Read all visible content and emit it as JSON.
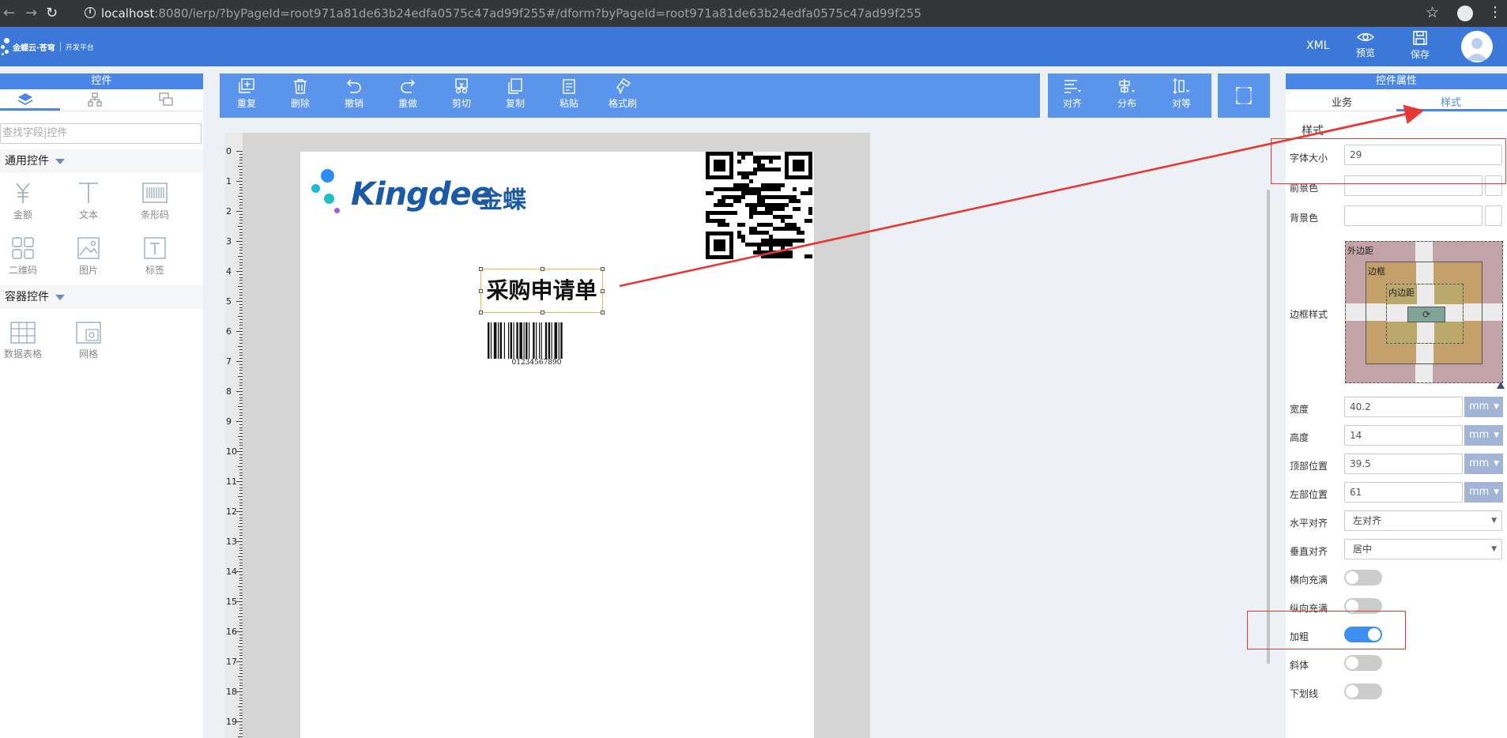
{
  "browser": {
    "url_host": "localhost",
    "url_rest": ":8080/ierp/?byPageId=root971a81de63b24edfa0575c47ad99f255#/dform?byPageId=root971a81de63b24edfa0575c47ad99f255"
  },
  "header": {
    "brand_name": "金蝶云·苍穹",
    "brand_platform": "开发平台",
    "xml": "XML",
    "preview": "预览",
    "save": "保存"
  },
  "left_panel": {
    "title": "控件",
    "search_placeholder": "查找字段|控件",
    "general_section": "通用控件",
    "general_controls": [
      {
        "label": "金额",
        "icon": "yen-icon"
      },
      {
        "label": "文本",
        "icon": "text-t-icon"
      },
      {
        "label": "条形码",
        "icon": "barcode-icon"
      },
      {
        "label": "二维码",
        "icon": "qrcode-icon"
      },
      {
        "label": "图片",
        "icon": "image-icon"
      },
      {
        "label": "标签",
        "icon": "label-t-icon"
      }
    ],
    "container_section": "容器控件",
    "container_controls": [
      {
        "label": "数据表格",
        "icon": "table-icon"
      },
      {
        "label": "网格",
        "icon": "grid-icon"
      }
    ]
  },
  "toolbar": {
    "items": [
      "重复",
      "删除",
      "撤销",
      "重做",
      "剪切",
      "复制",
      "粘贴",
      "格式刷"
    ],
    "align_items": [
      "对齐",
      "分布",
      "对等"
    ]
  },
  "canvas": {
    "ruler_marks": [
      "0",
      "1",
      "2",
      "3",
      "4",
      "5",
      "6",
      "7",
      "8",
      "9",
      "10",
      "11",
      "12",
      "13",
      "14",
      "15",
      "16",
      "17",
      "18",
      "19"
    ],
    "logo_text": "Kingdee",
    "logo_cn": "金蝶",
    "title_text": "采购申请单",
    "barcode_number": "01234567890"
  },
  "right_panel": {
    "title": "控件属性",
    "tab_business": "业务",
    "tab_style": "样式",
    "section_style": "样式",
    "font_size_label": "字体大小",
    "font_size_value": "29",
    "fg_label": "前景色",
    "bg_label": "背景色",
    "border_style_label": "边框样式",
    "box_outer": "外边距",
    "box_border": "边框",
    "box_inner": "内边距",
    "width_label": "宽度",
    "width_value": "40.2",
    "height_label": "高度",
    "height_value": "14",
    "top_label": "顶部位置",
    "top_value": "39.5",
    "left_label": "左部位置",
    "left_value": "61",
    "unit": "mm",
    "halign_label": "水平对齐",
    "halign_value": "左对齐",
    "valign_label": "垂直对齐",
    "valign_value": "居中",
    "hfill_label": "横向充满",
    "hfill_on": false,
    "vfill_label": "纵向充满",
    "vfill_on": false,
    "bold_label": "加粗",
    "bold_on": true,
    "italic_label": "斜体",
    "italic_on": false,
    "underline_label": "下划线",
    "underline_on": false
  },
  "colors": {
    "brand_blue": "#3b78d8",
    "toolbar_blue": "#5b94eb",
    "annotation_red": "#e53935",
    "toggle_on": "#3d8ef0"
  }
}
